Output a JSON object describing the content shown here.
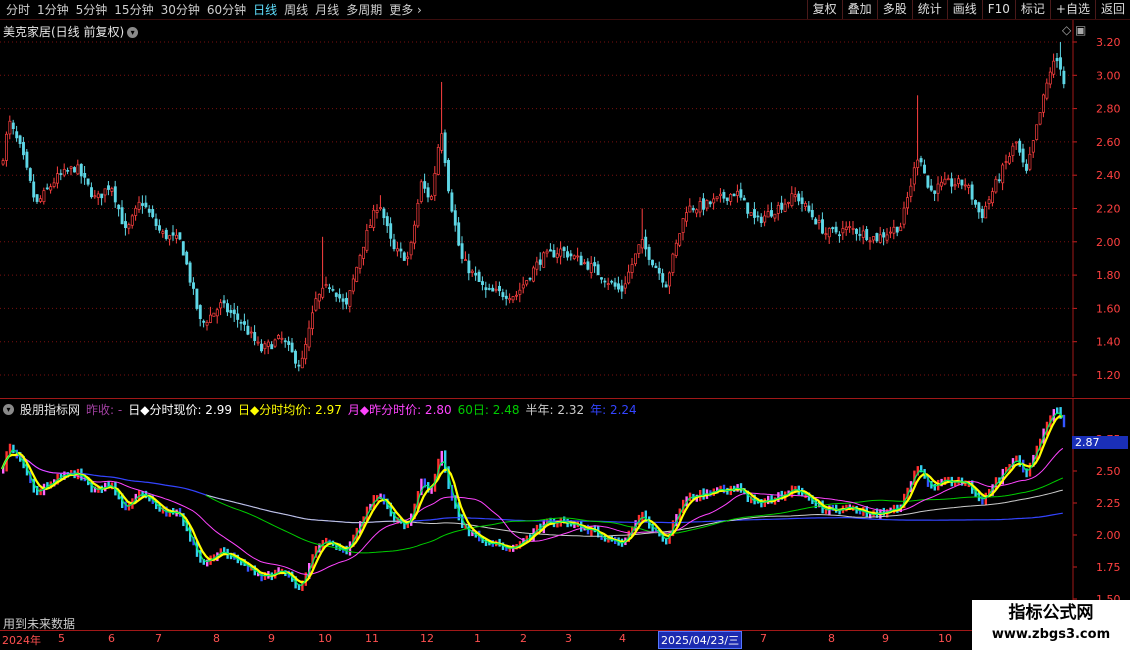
{
  "toolbar": {
    "tabs": [
      "分时",
      "1分钟",
      "5分钟",
      "15分钟",
      "30分钟",
      "60分钟",
      "日线",
      "周线",
      "月线",
      "多周期",
      "更多"
    ],
    "active_tab": "日线",
    "right_buttons": [
      "复权",
      "叠加",
      "多股",
      "统计",
      "画线",
      "F10",
      "标记",
      "+自选",
      "返回"
    ]
  },
  "main": {
    "title": "美克家居(日线 前复权)",
    "corner_icons": "◇ ▣"
  },
  "indicator": {
    "name": "股朋指标网",
    "prev_close_label": "昨收: -",
    "items": [
      {
        "label": "日◆分时现价:",
        "value": "2.99",
        "color": "#ffffff"
      },
      {
        "label": "日◆分时均价:",
        "value": "2.97",
        "color": "#ffff00"
      },
      {
        "label": "月◆昨分时价:",
        "value": "2.80",
        "color": "#ff44ff"
      },
      {
        "label": "60日:",
        "value": "2.48",
        "color": "#00cc00"
      },
      {
        "label": "半年:",
        "value": "2.32",
        "color": "#cccccc"
      },
      {
        "label": "年:",
        "value": "2.24",
        "color": "#3344ff"
      }
    ],
    "current_price_tag": "2.87",
    "future_label": "用到未来数据"
  },
  "date_axis": {
    "labels": [
      "2024年",
      "5",
      "6",
      "7",
      "8",
      "9",
      "10",
      "11",
      "12",
      "1",
      "2",
      "3",
      "4",
      "2025/04/23/三",
      "7",
      "8",
      "9",
      "10"
    ],
    "cursor_label": "2025/04/23/三"
  },
  "watermark": {
    "line1": "指标公式网",
    "line2": "www.zbgs3.com"
  },
  "chart_data": {
    "type": "candlestick",
    "main_yticks": [
      "3.20",
      "3.00",
      "2.80",
      "2.60",
      "2.40",
      "2.20",
      "2.00",
      "1.80",
      "1.60",
      "1.40",
      "1.20"
    ],
    "main_ylim": [
      1.2,
      3.2
    ],
    "sub_yticks": [
      "2.75",
      "2.50",
      "2.25",
      "2.00",
      "1.75",
      "1.50"
    ],
    "sub_ylim": [
      1.5,
      2.75
    ],
    "close_path": [
      [
        0,
        2.45
      ],
      [
        8,
        2.72
      ],
      [
        20,
        2.55
      ],
      [
        35,
        2.22
      ],
      [
        55,
        2.38
      ],
      [
        75,
        2.45
      ],
      [
        95,
        2.25
      ],
      [
        110,
        2.35
      ],
      [
        125,
        2.05
      ],
      [
        140,
        2.25
      ],
      [
        160,
        2.05
      ],
      [
        180,
        2.0
      ],
      [
        200,
        1.5
      ],
      [
        220,
        1.62
      ],
      [
        240,
        1.52
      ],
      [
        260,
        1.35
      ],
      [
        280,
        1.42
      ],
      [
        300,
        1.25
      ],
      [
        315,
        1.65
      ],
      [
        330,
        1.75
      ],
      [
        345,
        1.6
      ],
      [
        360,
        1.95
      ],
      [
        378,
        2.25
      ],
      [
        392,
        1.95
      ],
      [
        408,
        1.9
      ],
      [
        420,
        2.35
      ],
      [
        430,
        2.25
      ],
      [
        440,
        2.7
      ],
      [
        448,
        2.3
      ],
      [
        460,
        1.9
      ],
      [
        485,
        1.7
      ],
      [
        515,
        1.68
      ],
      [
        540,
        1.9
      ],
      [
        560,
        1.95
      ],
      [
        590,
        1.85
      ],
      [
        620,
        1.7
      ],
      [
        640,
        2.0
      ],
      [
        665,
        1.75
      ],
      [
        685,
        2.2
      ],
      [
        705,
        2.22
      ],
      [
        735,
        2.3
      ],
      [
        755,
        2.12
      ],
      [
        795,
        2.28
      ],
      [
        825,
        2.05
      ],
      [
        850,
        2.08
      ],
      [
        875,
        2.02
      ],
      [
        900,
        2.1
      ],
      [
        918,
        2.55
      ],
      [
        928,
        2.3
      ],
      [
        945,
        2.35
      ],
      [
        965,
        2.35
      ],
      [
        980,
        2.15
      ],
      [
        995,
        2.35
      ],
      [
        1015,
        2.6
      ],
      [
        1025,
        2.4
      ],
      [
        1040,
        2.8
      ],
      [
        1050,
        3.05
      ],
      [
        1058,
        3.1
      ],
      [
        1063,
        2.95
      ]
    ],
    "ma_lines": [
      {
        "name": "日◆分时均价",
        "color": "#ffff00"
      },
      {
        "name": "月◆昨分时价",
        "color": "#ff44ff"
      },
      {
        "name": "60日",
        "color": "#00cc00"
      },
      {
        "name": "半年",
        "color": "#cccccc"
      },
      {
        "name": "年",
        "color": "#3344ff"
      }
    ]
  }
}
